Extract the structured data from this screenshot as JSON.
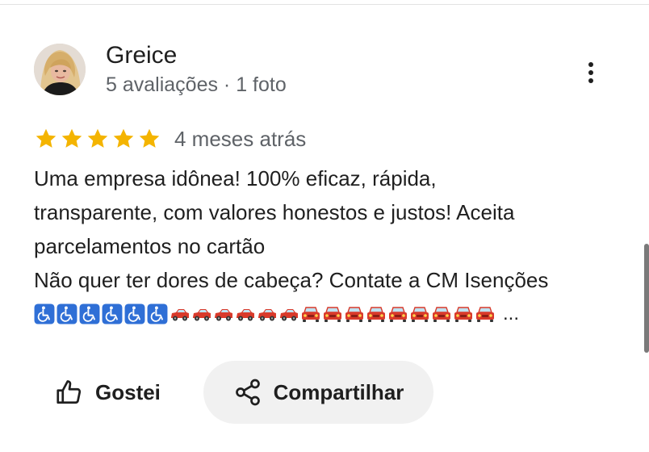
{
  "reviewer": {
    "name": "Greice",
    "meta": "5 avaliações · 1 foto"
  },
  "rating": {
    "stars": 5,
    "max_stars": 5,
    "date": "4 meses atrás",
    "star_color": "#f4b400"
  },
  "review": {
    "lines": [
      "Uma empresa idônea! 100% eficaz, rápida,",
      "transparente, com valores honestos e justos! Aceita",
      "parcelamentos no cartão",
      "Não quer ter dores de cabeça? Contate a CM Isenções"
    ],
    "emojis": {
      "wheelchair_count": 6,
      "red_car_side_count": 6,
      "red_car_front_count": 9
    },
    "truncation": "..."
  },
  "actions": {
    "like_label": "Gostei",
    "share_label": "Compartilhar"
  },
  "icons": {
    "more": "more-vertical-icon",
    "like": "thumbs-up-icon",
    "share": "share-icon",
    "star": "star-icon",
    "wheelchair": "wheelchair-emoji-icon",
    "car": "red-car-emoji-icon"
  }
}
